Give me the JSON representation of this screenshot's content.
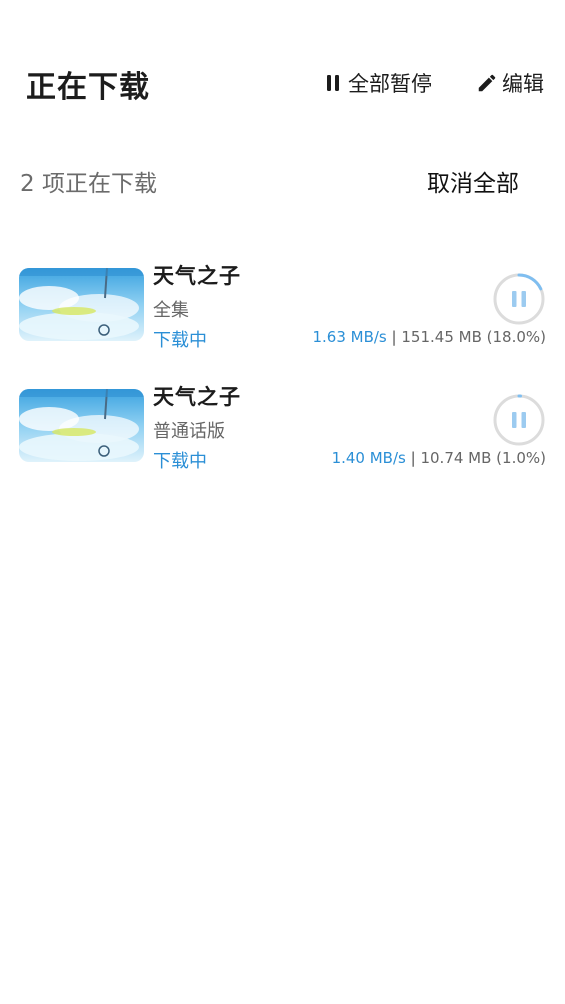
{
  "header": {
    "title": "正在下载",
    "pause_all_label": "全部暂停",
    "edit_label": "编辑"
  },
  "summary": {
    "count_text": "2 项正在下载",
    "cancel_all_label": "取消全部"
  },
  "downloads": [
    {
      "title": "天气之子",
      "subtitle": "全集",
      "status": "下载中",
      "speed": "1.63 MB/s",
      "separator": "|",
      "size_progress": "151.45 MB (18.0%)",
      "progress": 0.18
    },
    {
      "title": "天气之子",
      "subtitle": "普通话版",
      "status": "下载中",
      "speed": "1.40 MB/s",
      "separator": "|",
      "size_progress": "10.74 MB (1.0%)",
      "progress": 0.01
    }
  ],
  "colors": {
    "accent": "#2b8fd6",
    "ring_track": "#dcdcdc",
    "ring_progress": "#7fbef0",
    "pause_glyph": "#9ccbf0"
  }
}
